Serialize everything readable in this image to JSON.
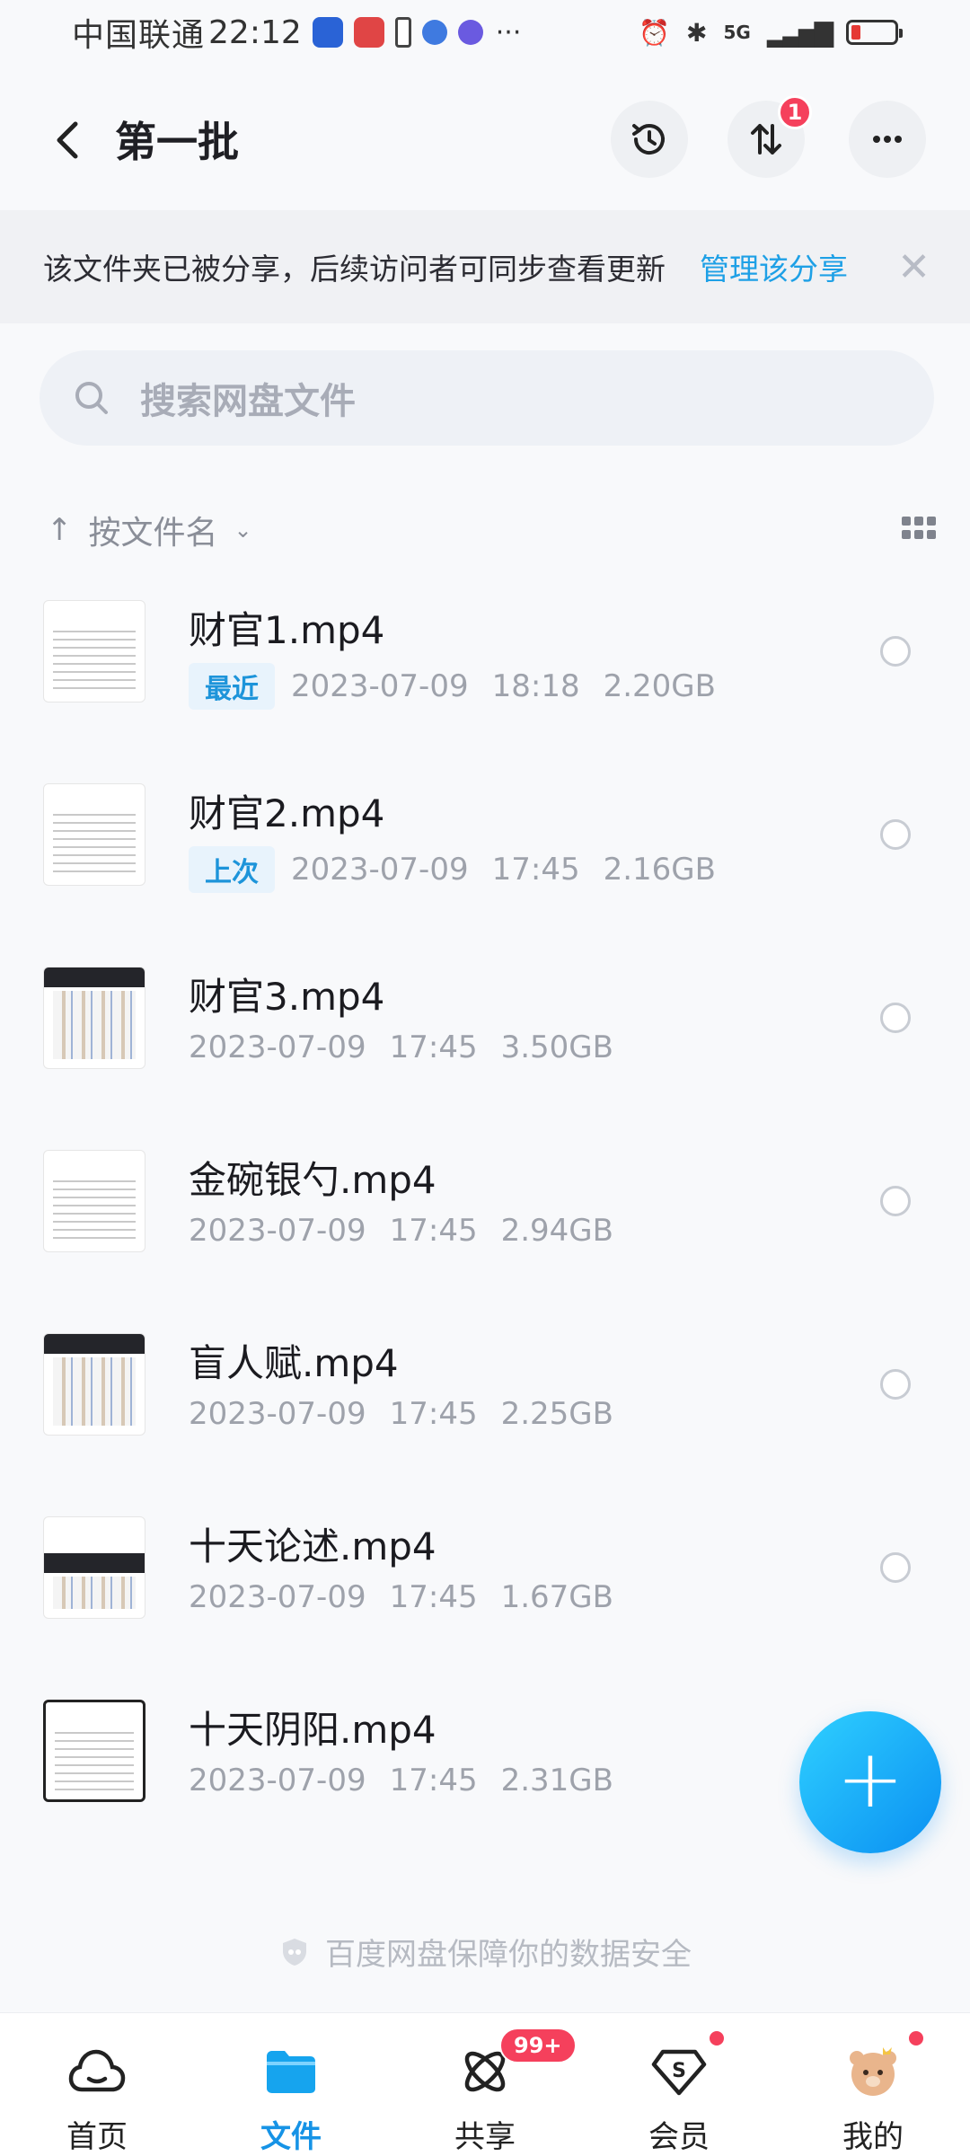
{
  "status_bar": {
    "carrier": "中国联通",
    "time": "22:12",
    "network": "5G"
  },
  "header": {
    "back_icon": "chevron-left-icon",
    "title": "第一批",
    "transfer_badge": "1"
  },
  "share_notice": {
    "text": "该文件夹已被分享，后续访问者可同步查看更新",
    "link": "管理该分享",
    "close": "✕"
  },
  "search": {
    "placeholder": "搜索网盘文件"
  },
  "sort": {
    "arrow": "↑",
    "label": "按文件名",
    "chevron": "⌄"
  },
  "files": [
    {
      "name": "财官1.mp4",
      "tag": "最近",
      "date": "2023-07-09",
      "time": "18:18",
      "size": "2.20GB"
    },
    {
      "name": "财官2.mp4",
      "tag": "上次",
      "date": "2023-07-09",
      "time": "17:45",
      "size": "2.16GB"
    },
    {
      "name": "财官3.mp4",
      "tag": "",
      "date": "2023-07-09",
      "time": "17:45",
      "size": "3.50GB"
    },
    {
      "name": "金碗银勺.mp4",
      "tag": "",
      "date": "2023-07-09",
      "time": "17:45",
      "size": "2.94GB"
    },
    {
      "name": "盲人赋.mp4",
      "tag": "",
      "date": "2023-07-09",
      "time": "17:45",
      "size": "2.25GB"
    },
    {
      "name": "十天论述.mp4",
      "tag": "",
      "date": "2023-07-09",
      "time": "17:45",
      "size": "1.67GB"
    },
    {
      "name": "十天阴阳.mp4",
      "tag": "",
      "date": "2023-07-09",
      "time": "17:45",
      "size": "2.31GB"
    }
  ],
  "fab": {
    "label": "+"
  },
  "security_note": "百度网盘保障你的数据安全",
  "tabs": [
    {
      "label": "首页"
    },
    {
      "label": "文件"
    },
    {
      "label": "共享",
      "badge": "99+"
    },
    {
      "label": "会员"
    },
    {
      "label": "我的"
    }
  ],
  "colors": {
    "accent": "#1693e6",
    "badge": "#f5405c",
    "link": "#1ea0e6"
  }
}
